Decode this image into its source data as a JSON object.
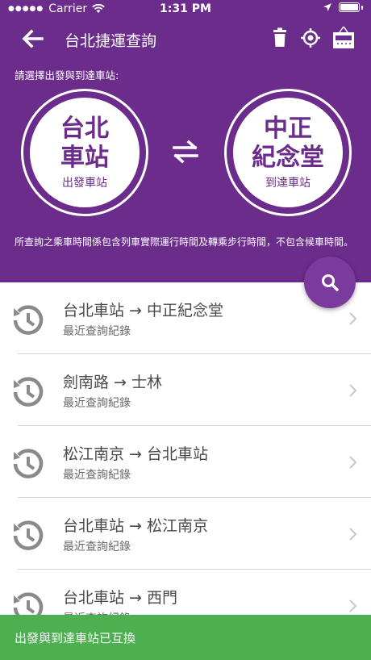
{
  "status": {
    "carrier": "Carrier",
    "time": "1:31 PM"
  },
  "nav": {
    "title": "台北捷運查詢",
    "icons": [
      "back-arrow-icon",
      "trash-icon",
      "locate-icon",
      "hotel-icon"
    ]
  },
  "prompt": "請選擇出發與到達車站:",
  "from": {
    "line1": "台北",
    "line2": "車站",
    "sub": "出發車站"
  },
  "to": {
    "line1": "中正",
    "line2": "紀念堂",
    "sub": "到達車站"
  },
  "note": "所查詢之乘車時間係包含列車實際運行時間及轉乘步行時間，不包含候車時間。",
  "history": [
    {
      "route": "台北車站 → 中正紀念堂",
      "sub": "最近查詢紀錄"
    },
    {
      "route": "劍南路 → 士林",
      "sub": "最近查詢紀錄"
    },
    {
      "route": "松江南京 → 台北車站",
      "sub": "最近查詢紀錄"
    },
    {
      "route": "台北車站 → 松江南京",
      "sub": "最近查詢紀錄"
    },
    {
      "route": "台北車站 → 西門",
      "sub": "最近查詢紀錄"
    }
  ],
  "toast": "出發與到達車站已互換",
  "colors": {
    "primary": "#6b2c8c",
    "fab": "#7b3a9e",
    "toast": "#4caf50",
    "history_icon": "#8a8a8a"
  }
}
